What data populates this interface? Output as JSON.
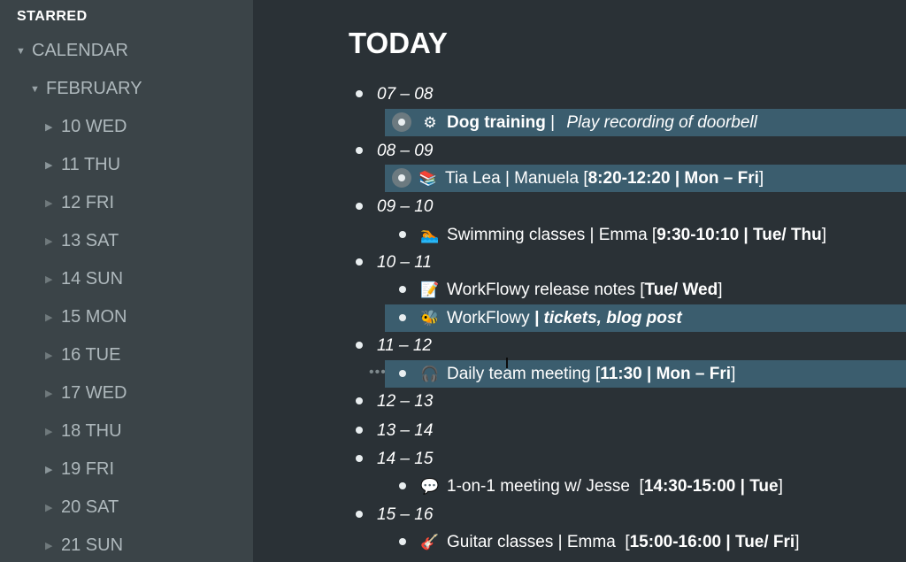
{
  "sidebar": {
    "starred_label": "STARRED",
    "calendar_label": "CALENDAR",
    "month_label": "FEBRUARY",
    "days": [
      {
        "label": "10 WED"
      },
      {
        "label": "11 THU"
      },
      {
        "label": "12 FRI"
      },
      {
        "label": "13 SAT"
      },
      {
        "label": "14 SUN"
      },
      {
        "label": "15 MON"
      },
      {
        "label": "16 TUE"
      },
      {
        "label": "17 WED"
      },
      {
        "label": "18 THU"
      },
      {
        "label": "19 FRI"
      },
      {
        "label": "20 SAT"
      },
      {
        "label": "21 SUN"
      }
    ]
  },
  "main": {
    "title": "TODAY",
    "slots": [
      {
        "hour": "07 – 08"
      },
      {
        "hour": "08 – 09"
      },
      {
        "hour": "09 – 10"
      },
      {
        "hour": "10 – 11"
      },
      {
        "hour": "11 – 12"
      },
      {
        "hour": "12 – 13"
      },
      {
        "hour": "13 – 14"
      },
      {
        "hour": "14 – 15"
      },
      {
        "hour": "15 – 16"
      }
    ],
    "items": {
      "dog": {
        "icon": "gear-icon",
        "title": "Dog training",
        "sep": " | ",
        "note": "Play recording of doorbell"
      },
      "tia": {
        "icon": "books-icon",
        "text": "Tia Lea | Manuela [",
        "sched": "8:20-12:20 | Mon – Fri",
        "end": "]"
      },
      "swim": {
        "icon": "swimmer-icon",
        "text": "Swimming classes | Emma [",
        "sched": "9:30-10:10 | Tue/ Thu",
        "end": "]"
      },
      "notes": {
        "icon": "memo-icon",
        "text": "WorkFlowy release notes [",
        "sched": "Tue/ Wed",
        "end": "]"
      },
      "wf": {
        "icon": "bee-icon",
        "text": "WorkFlowy ",
        "sched": "| tickets, blog post"
      },
      "meeting": {
        "icon": "headphones-icon",
        "text": "Daily team meeting [",
        "sched": "11:30 | Mon – Fri",
        "end": "]"
      },
      "jesse": {
        "icon": "speech-bubble-icon",
        "text": "1-on-1 meeting w/ Jesse  [",
        "sched": "14:30-15:00 | Tue",
        "end": "]"
      },
      "guitar": {
        "icon": "guitar-icon",
        "text": "Guitar classes | Emma  [",
        "sched": "15:00-16:00 | Tue/ Fri",
        "end": "]"
      }
    }
  },
  "colors": {
    "sidebar_bg": "#3b4448",
    "main_bg": "#2a3136",
    "highlight_bg": "#3b5d6e"
  }
}
